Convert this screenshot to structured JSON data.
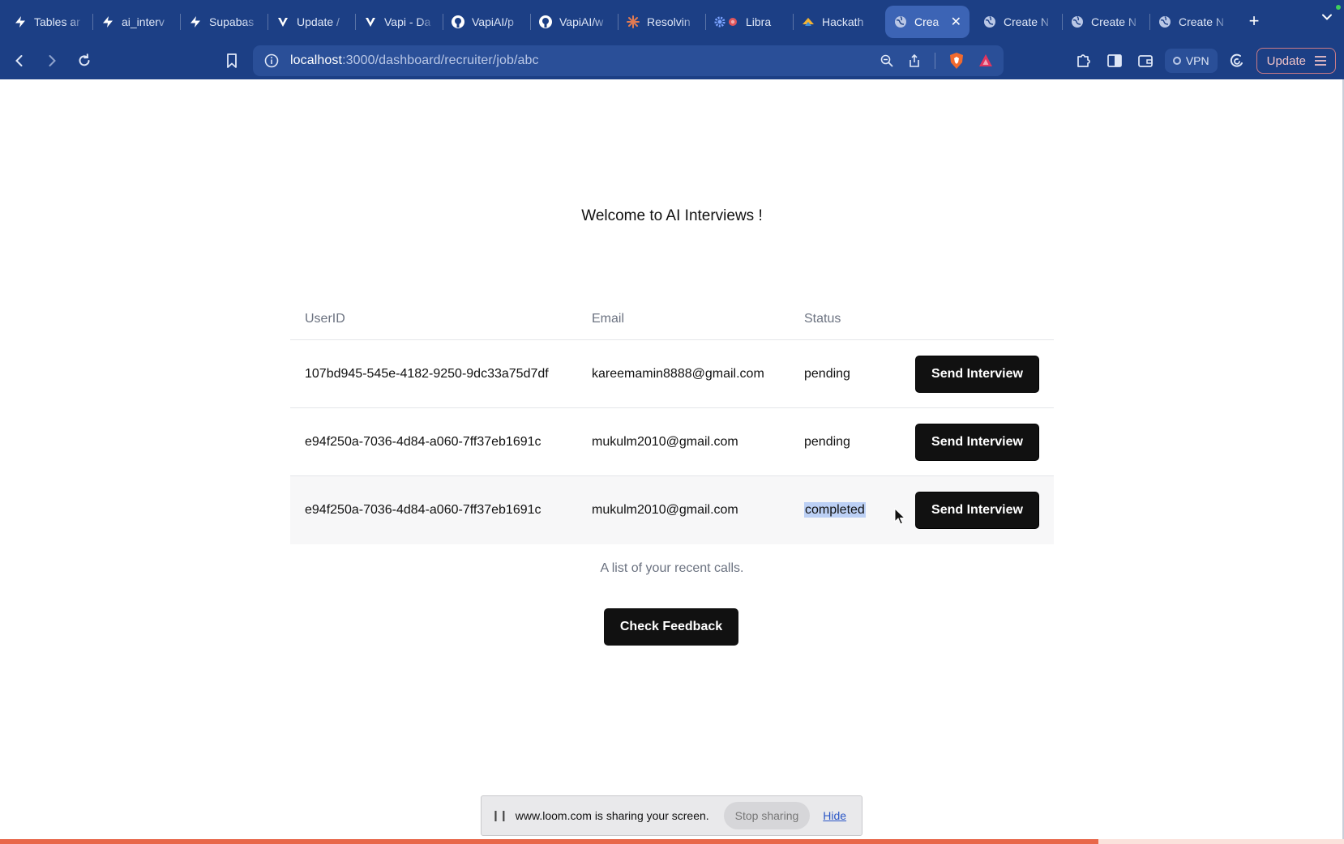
{
  "browser": {
    "tabs": [
      {
        "label": "Tables ar",
        "favicon": "supabase-icon",
        "active": false
      },
      {
        "label": "ai_interv",
        "favicon": "supabase-icon",
        "active": false
      },
      {
        "label": "Supabas",
        "favicon": "supabase-icon",
        "active": false
      },
      {
        "label": "Update /",
        "favicon": "vapi-icon",
        "active": false
      },
      {
        "label": "Vapi - Da",
        "favicon": "vapi-icon",
        "active": false
      },
      {
        "label": "VapiAI/p",
        "favicon": "github-icon",
        "active": false
      },
      {
        "label": "VapiAI/w",
        "favicon": "github-icon",
        "active": false
      },
      {
        "label": "Resolvin",
        "favicon": "claude-icon",
        "active": false
      },
      {
        "label": "Libra",
        "favicon": "gear-icon",
        "active": false
      },
      {
        "label": "Hackath",
        "favicon": "hackathon-icon",
        "active": false
      },
      {
        "label": "Crea",
        "favicon": "globe-icon",
        "active": true
      },
      {
        "label": "Create N",
        "favicon": "globe-icon",
        "active": false
      },
      {
        "label": "Create N",
        "favicon": "globe-icon",
        "active": false
      },
      {
        "label": "Create N",
        "favicon": "globe-icon",
        "active": false
      }
    ],
    "url_host": "localhost",
    "url_path": ":3000/dashboard/recruiter/job/abc",
    "vpn_label": "VPN",
    "update_label": "Update",
    "colors": {
      "chrome": "#1c3f85",
      "omnibox": "#2a4f98"
    }
  },
  "page": {
    "title": "Welcome to AI Interviews !",
    "table": {
      "headers": [
        "UserID",
        "Email",
        "Status"
      ],
      "rows": [
        {
          "user_id": "107bd945-545e-4182-9250-9dc33a75d7df",
          "email": "kareemamin8888@gmail.com",
          "status": "pending",
          "action": "Send Interview"
        },
        {
          "user_id": "e94f250a-7036-4d84-a060-7ff37eb1691c",
          "email": "mukulm2010@gmail.com",
          "status": "pending",
          "action": "Send Interview"
        },
        {
          "user_id": "e94f250a-7036-4d84-a060-7ff37eb1691c",
          "email": "mukulm2010@gmail.com",
          "status": "completed",
          "action": "Send Interview"
        }
      ],
      "caption": "A list of your recent calls."
    },
    "feedback_button": "Check Feedback"
  },
  "loom": {
    "message": "www.loom.com is sharing your screen.",
    "stop_label": "Stop sharing",
    "hide_label": "Hide",
    "progress": 0.817,
    "progress_color": "#e8674a"
  }
}
